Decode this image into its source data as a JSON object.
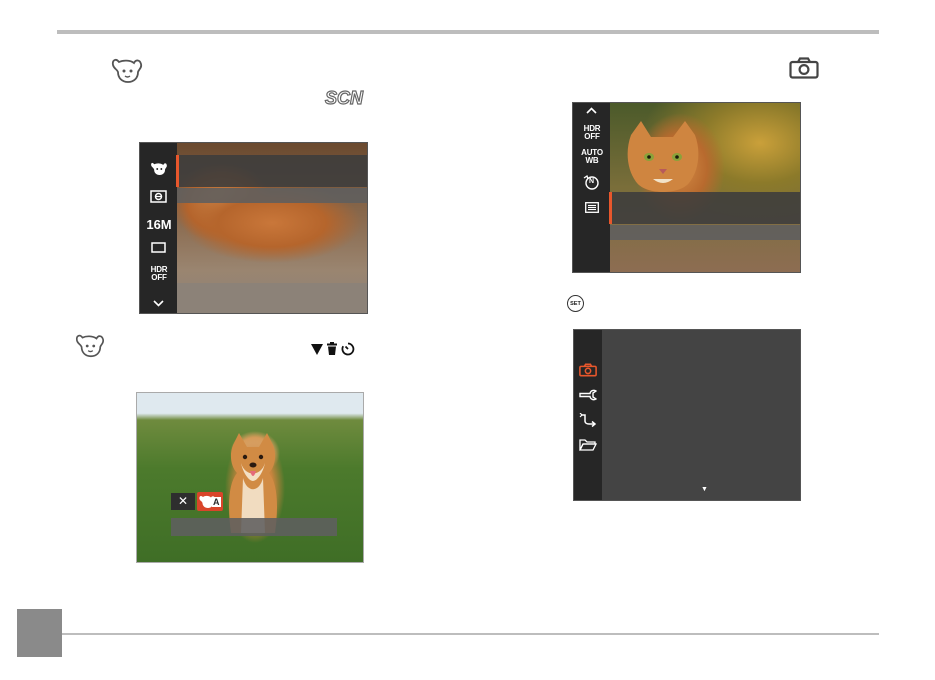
{
  "page": {
    "colors": {
      "rule": "#bdbdbd",
      "page_tab": "#8a8a8a",
      "accent": "#e8572c",
      "screen_bg": "#262626"
    }
  },
  "header_icons": {
    "left_icon": "pet-mode-icon",
    "left_badge": "SCN",
    "right_icon": "camera-icon"
  },
  "screen1": {
    "side_items": [
      {
        "icon": "pet-mode-icon"
      },
      {
        "icon": "metering-icon"
      },
      {
        "text": "16M"
      },
      {
        "icon": "aspect-ratio-icon"
      },
      {
        "text_top": "HDR",
        "text_bottom": "OFF"
      },
      {
        "icon": "chevron-down-icon"
      }
    ]
  },
  "instruction_row": {
    "left_icon": "pet-mode-icon",
    "right_icons": [
      "triangle-down-icon",
      "trash-icon",
      "self-timer-icon"
    ]
  },
  "screen3": {
    "controls": [
      {
        "icon": "close-icon",
        "label": "✕"
      },
      {
        "icon": "pet-auto-icon",
        "label": "A"
      }
    ]
  },
  "screen2": {
    "side_items": [
      {
        "icon": "chevron-up-icon"
      },
      {
        "text_top": "HDR",
        "text_bottom": "OFF"
      },
      {
        "text_top": "AUTO",
        "text_bottom": "WB"
      },
      {
        "icon": "color-mode-icon",
        "label": "N"
      },
      {
        "icon": "menu-list-icon"
      }
    ]
  },
  "set_button": {
    "label": "SET"
  },
  "screen4": {
    "side_items": [
      {
        "icon": "camera-icon",
        "active": true
      },
      {
        "icon": "wrench-icon"
      },
      {
        "icon": "transfer-icon"
      },
      {
        "icon": "folder-icon"
      }
    ],
    "scroll_indicator": "▼"
  }
}
